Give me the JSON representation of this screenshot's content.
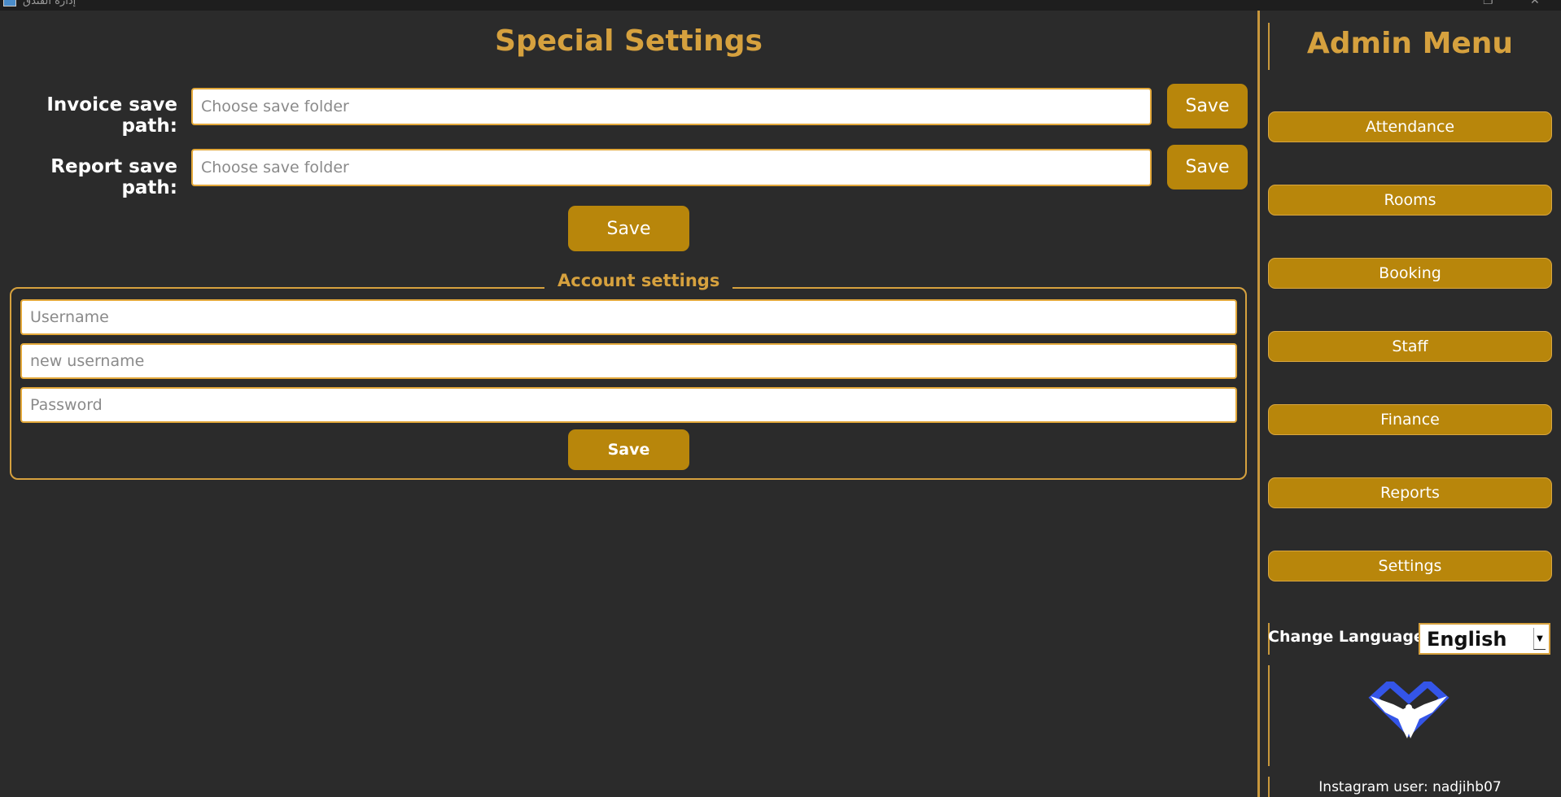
{
  "window": {
    "title": "إدارة الفندق"
  },
  "main": {
    "title": "Special Settings",
    "invoice_label": "Invoice save path:",
    "invoice_placeholder": "Choose save folder",
    "invoice_save": "Save",
    "report_label": "Report save path:",
    "report_placeholder": "Choose save folder",
    "report_save": "Save",
    "paths_save": "Save",
    "account": {
      "legend": "Account settings",
      "username_placeholder": "Username",
      "new_username_placeholder": "new username",
      "password_placeholder": "Password",
      "save": "Save"
    }
  },
  "sidebar": {
    "title": "Admin Menu",
    "items": [
      {
        "label": "Attendance"
      },
      {
        "label": "Rooms"
      },
      {
        "label": "Booking"
      },
      {
        "label": "Staff"
      },
      {
        "label": "Finance"
      },
      {
        "label": "Reports"
      },
      {
        "label": "Settings"
      }
    ],
    "language_label": "Change Language",
    "language_value": "English",
    "logo_icon": "eagle-logo-icon",
    "instagram": "Instagram user: nadjihb07"
  },
  "colors": {
    "background": "#2b2b2b",
    "accent_gold": "#d6a13e",
    "button_gold": "#b8860b",
    "logo_blue": "#3455e8"
  }
}
